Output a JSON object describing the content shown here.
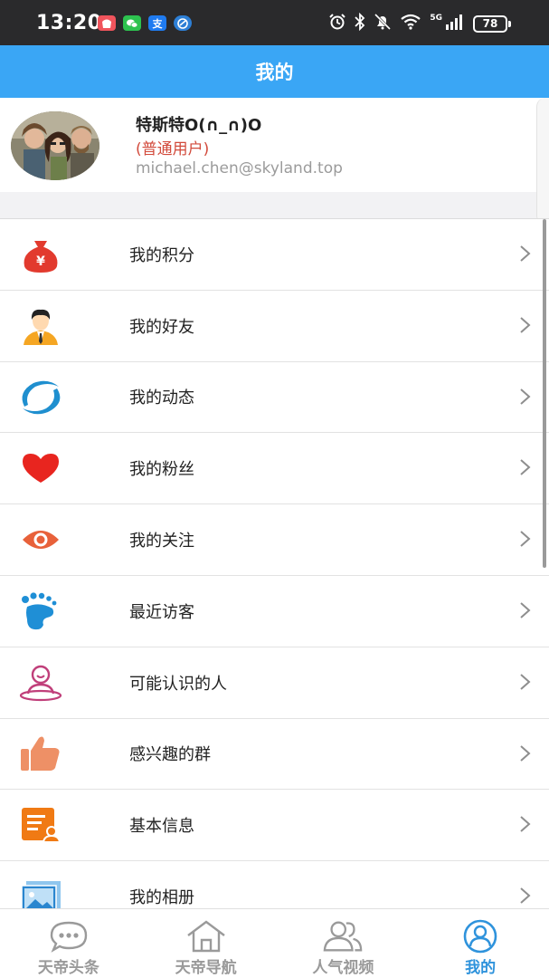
{
  "status_bar": {
    "time": "13:20",
    "network": "5G",
    "battery": "78"
  },
  "header": {
    "title": "我的"
  },
  "profile": {
    "name": "特斯特O(∩_∩)O",
    "role": "(普通用户)",
    "email": "michael.chen@skyland.top"
  },
  "menu": {
    "items": [
      {
        "label": "我的积分",
        "icon": "money-bag-icon"
      },
      {
        "label": "我的好友",
        "icon": "friend-person-icon"
      },
      {
        "label": "我的动态",
        "icon": "swirl-activity-icon"
      },
      {
        "label": "我的粉丝",
        "icon": "heart-icon"
      },
      {
        "label": "我的关注",
        "icon": "eye-icon"
      },
      {
        "label": "最近访客",
        "icon": "footprint-icon"
      },
      {
        "label": "可能认识的人",
        "icon": "person-location-icon"
      },
      {
        "label": "感兴趣的群",
        "icon": "thumbs-up-icon"
      },
      {
        "label": "基本信息",
        "icon": "info-document-icon"
      },
      {
        "label": "我的相册",
        "icon": "photo-album-icon"
      }
    ]
  },
  "tabbar": {
    "tabs": [
      {
        "label": "天帝头条",
        "icon": "chat-bubble-icon"
      },
      {
        "label": "天帝导航",
        "icon": "home-icon"
      },
      {
        "label": "人气视频",
        "icon": "people-icon"
      },
      {
        "label": "我的",
        "icon": "profile-icon",
        "active": true
      }
    ]
  },
  "colors": {
    "header": "#3aa6f5",
    "active_tab": "#2f93dc",
    "role_text": "#d24a3b"
  }
}
